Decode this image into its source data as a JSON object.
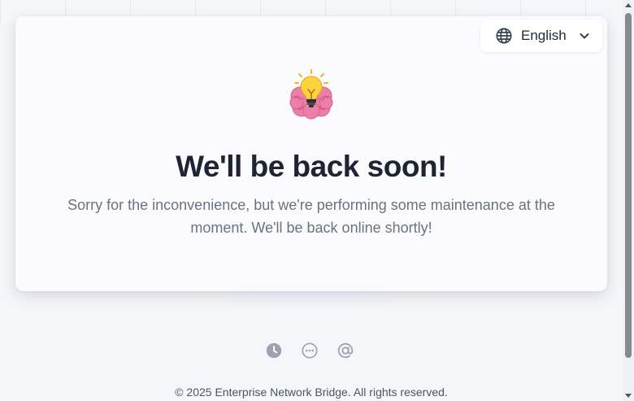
{
  "language_selector": {
    "label": "English",
    "icon": "globe-icon",
    "dropdown_icon": "chevron-down-icon"
  },
  "illustration": {
    "icon": "brain-lightbulb-icon"
  },
  "main": {
    "headline": "We'll be back soon!",
    "message": "Sorry for the inconvenience, but we're performing some maintenance at the moment. We'll be back online shortly!"
  },
  "footer": {
    "icons": [
      "clock-icon",
      "more-dots-icon",
      "at-sign-icon"
    ],
    "copyright": "© 2025 Enterprise Network Bridge. All rights reserved."
  },
  "colors": {
    "headline": "#1e2433",
    "message": "#6b7280",
    "footer_icon": "#9ca3af",
    "background": "#f5f6fa",
    "card": "#fbfbfd"
  }
}
